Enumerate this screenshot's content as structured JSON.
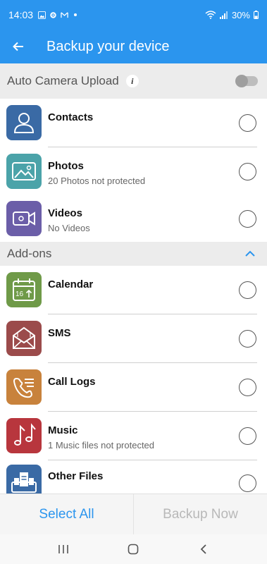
{
  "status_bar": {
    "time": "14:03",
    "battery": "30%"
  },
  "header": {
    "title": "Backup your device"
  },
  "auto_upload": {
    "label": "Auto Camera Upload",
    "info_glyph": "i",
    "toggle_on": false
  },
  "items": [
    {
      "title": "Contacts",
      "subtitle": "",
      "color": "#3a6aa5",
      "icon": "person-icon"
    },
    {
      "title": "Photos",
      "subtitle": "20 Photos not protected",
      "color": "#4ba3a9",
      "icon": "image-icon"
    },
    {
      "title": "Videos",
      "subtitle": "No Videos",
      "color": "#6b5ea8",
      "icon": "video-camera-icon"
    }
  ],
  "addons": {
    "label": "Add-ons",
    "items": [
      {
        "title": "Calendar",
        "subtitle": "",
        "color": "#6f9a48",
        "icon": "calendar-icon",
        "calendar_day": "16"
      },
      {
        "title": "SMS",
        "subtitle": "",
        "color": "#9b4b4b",
        "icon": "envelope-icon"
      },
      {
        "title": "Call Logs",
        "subtitle": "",
        "color": "#c8823c",
        "icon": "phone-icon"
      },
      {
        "title": "Music",
        "subtitle": "1 Music files not protected",
        "color": "#b8363d",
        "icon": "music-notes-icon"
      },
      {
        "title": "Other Files",
        "subtitle": "",
        "color": "#3a6aa5",
        "icon": "files-icon"
      }
    ]
  },
  "footer": {
    "select_all": "Select All",
    "backup_now": "Backup Now"
  },
  "colors": {
    "primary": "#2b95ee",
    "disabled": "#b8b8b8"
  }
}
